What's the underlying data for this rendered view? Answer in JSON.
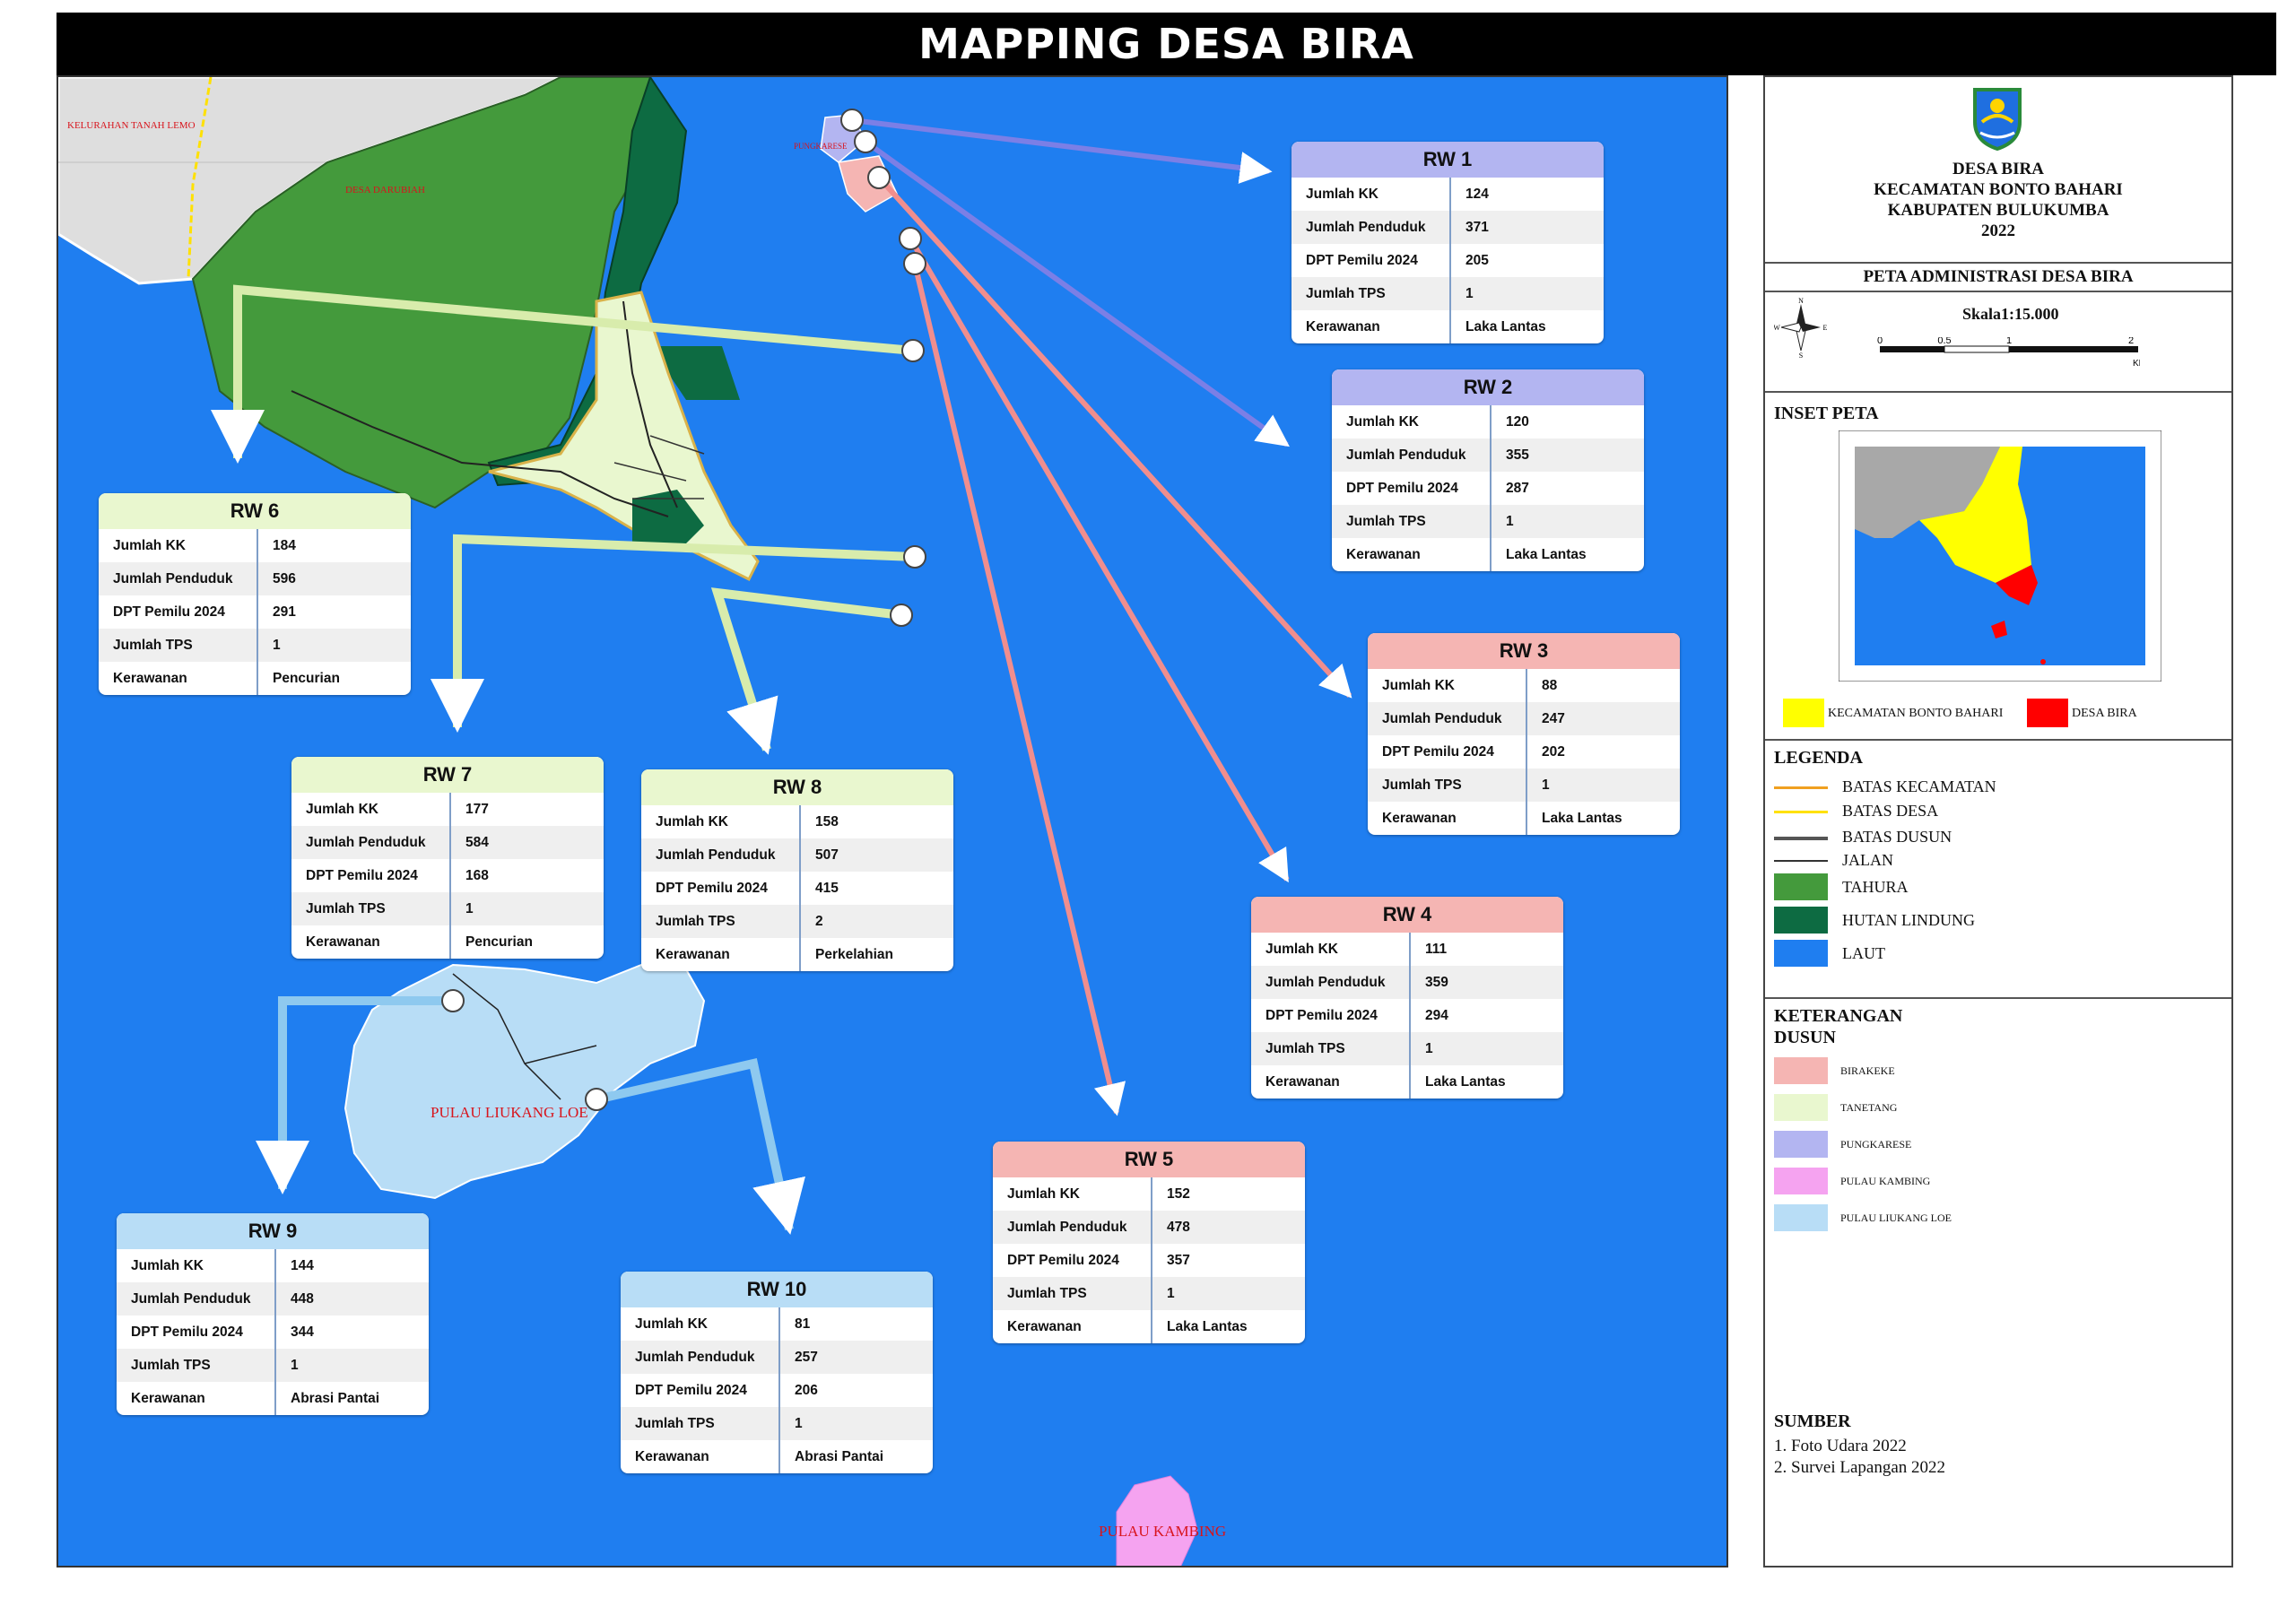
{
  "title": "MAPPING DESA BIRA",
  "map_labels": {
    "kelurahan": "KELURAHAN TANAH LEMO",
    "desa_darubiah": "DESA DARUBIAH",
    "pungkarese": "PUNGKARESE",
    "pulau_liukang": "PULAU LIUKANG LOE",
    "pulau_kambing": "PULAU KAMBING"
  },
  "colors": {
    "laut": "#1f7ef0",
    "tahura": "#449a3c",
    "hutan_lindung": "#0d6b42",
    "land_grey": "#dedede",
    "tanetang": "#e9f7cf",
    "pungkarese": "#b3b5f1",
    "birakeke": "#f5b5b3",
    "pulau_kambing": "#f5a3f0",
    "pulau_liukang": "#b8ddf6"
  },
  "cards": [
    {
      "id": "rw1",
      "title": "RW 1",
      "header_color": "#b3b5f1",
      "rows": [
        {
          "label": "Jumlah KK",
          "value": "124"
        },
        {
          "label": "Jumlah Penduduk",
          "value": "371"
        },
        {
          "label": "DPT Pemilu 2024",
          "value": "205"
        },
        {
          "label": "Jumlah TPS",
          "value": "1"
        },
        {
          "label": "Kerawanan",
          "value": "Laka Lantas"
        }
      ]
    },
    {
      "id": "rw2",
      "title": "RW 2",
      "header_color": "#b3b5f1",
      "rows": [
        {
          "label": "Jumlah KK",
          "value": "120"
        },
        {
          "label": "Jumlah Penduduk",
          "value": "355"
        },
        {
          "label": "DPT Pemilu 2024",
          "value": "287"
        },
        {
          "label": "Jumlah TPS",
          "value": "1"
        },
        {
          "label": "Kerawanan",
          "value": "Laka Lantas"
        }
      ]
    },
    {
      "id": "rw3",
      "title": "RW 3",
      "header_color": "#f5b5b3",
      "rows": [
        {
          "label": "Jumlah KK",
          "value": "88"
        },
        {
          "label": "Jumlah Penduduk",
          "value": "247"
        },
        {
          "label": "DPT Pemilu 2024",
          "value": "202"
        },
        {
          "label": "Jumlah TPS",
          "value": "1"
        },
        {
          "label": "Kerawanan",
          "value": "Laka Lantas"
        }
      ]
    },
    {
      "id": "rw4",
      "title": "RW 4",
      "header_color": "#f5b5b3",
      "rows": [
        {
          "label": "Jumlah KK",
          "value": "111"
        },
        {
          "label": "Jumlah Penduduk",
          "value": "359"
        },
        {
          "label": "DPT Pemilu 2024",
          "value": "294"
        },
        {
          "label": "Jumlah TPS",
          "value": "1"
        },
        {
          "label": "Kerawanan",
          "value": "Laka Lantas"
        }
      ]
    },
    {
      "id": "rw5",
      "title": "RW 5",
      "header_color": "#f5b5b3",
      "rows": [
        {
          "label": "Jumlah KK",
          "value": "152"
        },
        {
          "label": "Jumlah Penduduk",
          "value": "478"
        },
        {
          "label": "DPT Pemilu 2024",
          "value": "357"
        },
        {
          "label": "Jumlah TPS",
          "value": "1"
        },
        {
          "label": "Kerawanan",
          "value": "Laka Lantas"
        }
      ]
    },
    {
      "id": "rw6",
      "title": "RW 6",
      "header_color": "#e9f7cf",
      "rows": [
        {
          "label": "Jumlah KK",
          "value": "184"
        },
        {
          "label": "Jumlah Penduduk",
          "value": "596"
        },
        {
          "label": "DPT Pemilu 2024",
          "value": "291"
        },
        {
          "label": "Jumlah TPS",
          "value": "1"
        },
        {
          "label": "Kerawanan",
          "value": "Pencurian"
        }
      ]
    },
    {
      "id": "rw7",
      "title": "RW 7",
      "header_color": "#e9f7cf",
      "rows": [
        {
          "label": "Jumlah KK",
          "value": "177"
        },
        {
          "label": "Jumlah Penduduk",
          "value": "584"
        },
        {
          "label": "DPT Pemilu 2024",
          "value": "168"
        },
        {
          "label": "Jumlah TPS",
          "value": "1"
        },
        {
          "label": "Kerawanan",
          "value": "Pencurian"
        }
      ]
    },
    {
      "id": "rw8",
      "title": "RW 8",
      "header_color": "#e9f7cf",
      "rows": [
        {
          "label": "Jumlah KK",
          "value": "158"
        },
        {
          "label": "Jumlah Penduduk",
          "value": "507"
        },
        {
          "label": "DPT Pemilu 2024",
          "value": "415"
        },
        {
          "label": "Jumlah TPS",
          "value": "2"
        },
        {
          "label": "Kerawanan",
          "value": "Perkelahian"
        }
      ]
    },
    {
      "id": "rw9",
      "title": "RW 9",
      "header_color": "#b8ddf6",
      "rows": [
        {
          "label": "Jumlah KK",
          "value": "144"
        },
        {
          "label": "Jumlah Penduduk",
          "value": "448"
        },
        {
          "label": "DPT Pemilu 2024",
          "value": "344"
        },
        {
          "label": "Jumlah TPS",
          "value": "1"
        },
        {
          "label": "Kerawanan",
          "value": "Abrasi Pantai"
        }
      ]
    },
    {
      "id": "rw10",
      "title": "RW 10",
      "header_color": "#b8ddf6",
      "rows": [
        {
          "label": "Jumlah KK",
          "value": "81"
        },
        {
          "label": "Jumlah Penduduk",
          "value": "257"
        },
        {
          "label": "DPT Pemilu 2024",
          "value": "206"
        },
        {
          "label": "Jumlah TPS",
          "value": "1"
        },
        {
          "label": "Kerawanan",
          "value": "Abrasi Pantai"
        }
      ]
    }
  ],
  "sidebar": {
    "heading": {
      "line1": "DESA BIRA",
      "line2": "KECAMATAN BONTO BAHARI",
      "line3": "KABUPATEN BULUKUMBA",
      "year": "2022"
    },
    "map_title": "PETA ADMINISTRASI DESA BIRA",
    "scale_label": "Skala1:15.000",
    "scale_ticks": [
      "0",
      "0.5",
      "1",
      "2"
    ],
    "scale_unit": "KM",
    "compass": {
      "n": "N",
      "e": "E",
      "s": "S",
      "w": "W"
    },
    "inset_title": "INSET PETA",
    "inset_legend": [
      {
        "label": "KECAMATAN BONTO BAHARI",
        "color": "#ffff00"
      },
      {
        "label": "DESA BIRA",
        "color": "#ff0000"
      }
    ],
    "legend_title": "LEGENDA",
    "legend": [
      {
        "label": "BATAS KECAMATAN",
        "type": "line",
        "color": "#f0a020"
      },
      {
        "label": "BATAS DESA",
        "type": "line",
        "color": "#ffe100"
      },
      {
        "label": "BATAS DUSUN",
        "type": "line",
        "color": "#555555"
      },
      {
        "label": "JALAN",
        "type": "line",
        "color": "#333333"
      },
      {
        "label": "TAHURA",
        "type": "fill",
        "color": "#449a3c"
      },
      {
        "label": "HUTAN LINDUNG",
        "type": "fill",
        "color": "#0d6b42"
      },
      {
        "label": "LAUT",
        "type": "fill",
        "color": "#1f7ef0"
      }
    ],
    "keterangan_title_1": "KETERANGAN",
    "keterangan_title_2": "DUSUN",
    "keterangan": [
      {
        "label": "BIRAKEKE",
        "color": "#f5b5b3"
      },
      {
        "label": "TANETANG",
        "color": "#e9f7cf"
      },
      {
        "label": "PUNGKARESE",
        "color": "#b3b5f1"
      },
      {
        "label": "PULAU KAMBING",
        "color": "#f5a3f0"
      },
      {
        "label": "PULAU LIUKANG LOE",
        "color": "#b8ddf6"
      }
    ],
    "sumber_title": "SUMBER",
    "sumber": [
      "1. Foto Udara 2022",
      "2. Survei Lapangan 2022"
    ]
  }
}
